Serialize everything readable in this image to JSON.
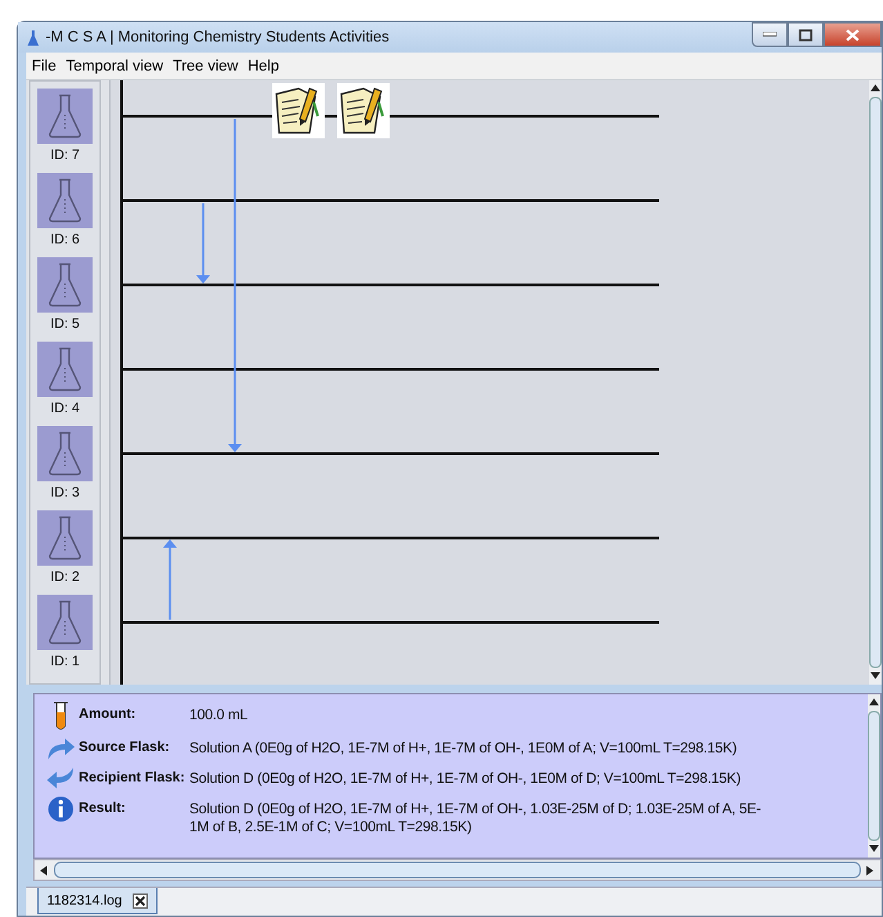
{
  "window": {
    "title": "-M C S A |  Monitoring Chemistry Students Activities"
  },
  "menu": [
    "File",
    "Temporal view",
    "Tree view",
    "Help"
  ],
  "flasks": [
    {
      "label": "ID: 7"
    },
    {
      "label": "ID: 6"
    },
    {
      "label": "ID: 5"
    },
    {
      "label": "ID: 4"
    },
    {
      "label": "ID: 3"
    },
    {
      "label": "ID: 2"
    },
    {
      "label": "ID: 1"
    }
  ],
  "details": [
    {
      "kind": "amount",
      "label": "Amount:",
      "value": "100.0 mL"
    },
    {
      "kind": "source",
      "label": "Source Flask:",
      "value": "Solution A (0E0g of H2O, 1E-7M of H+, 1E-7M of OH-, 1E0M of A; V=100mL T=298.15K)"
    },
    {
      "kind": "recipient",
      "label": "Recipient Flask:",
      "value": "Solution D (0E0g of H2O, 1E-7M of H+, 1E-7M of OH-, 1E0M of D; V=100mL T=298.15K)"
    },
    {
      "kind": "result",
      "label": "Result:",
      "value": "Solution D (0E0g of H2O, 1E-7M of H+, 1E-7M of OH-, 1.03E-25M of D; 1.03E-25M of A, 5E-1M of B, 2.5E-1M of C; V=100mL T=298.15K)"
    }
  ],
  "tabs": [
    {
      "label": "1182314.log",
      "selected": true
    }
  ]
}
